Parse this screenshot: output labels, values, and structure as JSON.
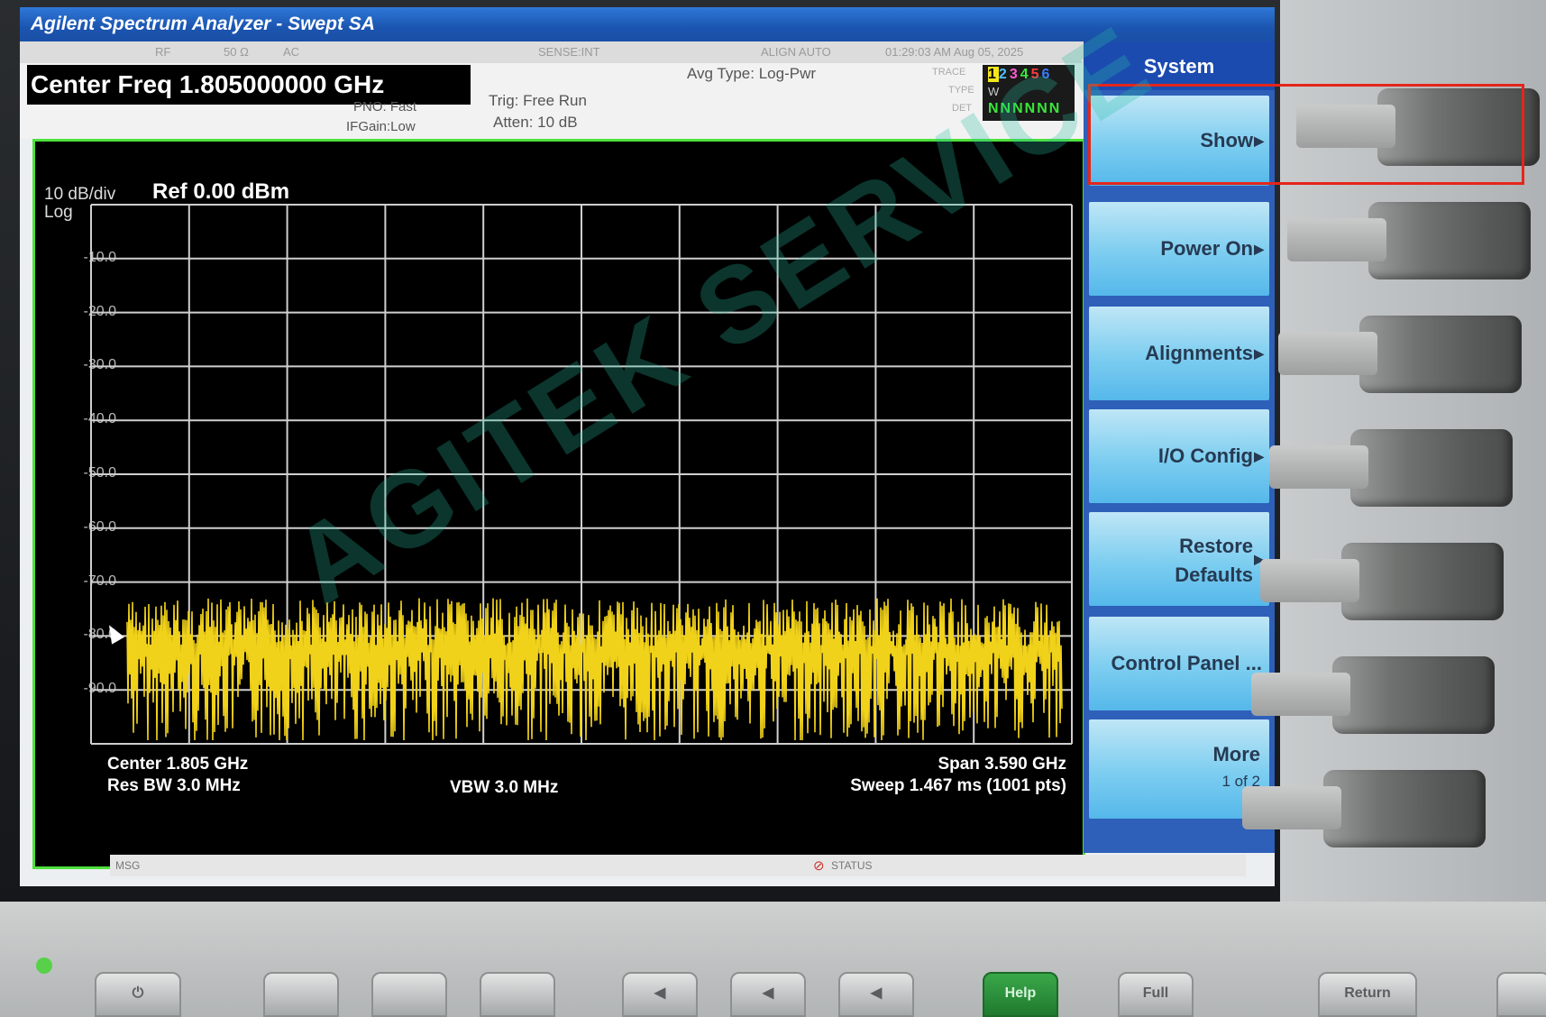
{
  "window": {
    "title": "Agilent Spectrum Analyzer - Swept SA"
  },
  "status_row": {
    "rf": "RF",
    "impedance": "50 Ω",
    "coupling": "AC",
    "sense": "SENSE:INT",
    "align": "ALIGN AUTO",
    "datetime": "01:29:03 AM Aug 05, 2025"
  },
  "measurement": {
    "center_freq": "Center Freq 1.805000000 GHz",
    "pno": "PNO: Fast",
    "if_gain": "IFGain:Low",
    "trigger": "Trig: Free Run",
    "atten": "Atten: 10 dB",
    "avg_type": "Avg Type: Log-Pwr",
    "trace_label": "TRACE",
    "type_label": "TYPE",
    "det_label": "DET",
    "trace_numbers": [
      "1",
      "2",
      "3",
      "4",
      "5",
      "6"
    ],
    "trace_colors": [
      "#f5e61c",
      "#4fc0ff",
      "#ff5cd0",
      "#3de83d",
      "#ff3b3b",
      "#3b7bff"
    ],
    "type_row": "W",
    "det_row": "NNNNNN"
  },
  "graph": {
    "scale": "10 dB/div",
    "scale_type": "Log",
    "ref": "Ref 0.00 dBm",
    "center": "Center 1.805 GHz",
    "res_bw": "Res BW 3.0 MHz",
    "vbw": "VBW 3.0 MHz",
    "span": "Span 3.590 GHz",
    "sweep": "Sweep  1.467 ms (1001 pts)",
    "y_ticks": [
      "-10.0",
      "-20.0",
      "-30.0",
      "-40.0",
      "-50.0",
      "-60.0",
      "-70.0",
      "-80.0",
      "-90.0"
    ],
    "trace_color": "#f1d21a"
  },
  "msg_bar": {
    "msg": "MSG",
    "status": "STATUS"
  },
  "softkeys": {
    "title": "System",
    "items": [
      {
        "label": "Show"
      },
      {
        "label": "Power On"
      },
      {
        "label": "Alignments"
      },
      {
        "label": "I/O Config"
      },
      {
        "line1": "Restore",
        "line2": "Defaults"
      },
      {
        "label": "Control Panel ..."
      },
      {
        "line1": "More",
        "line2": "1 of 2"
      }
    ]
  },
  "front_panel": {
    "help": "Help",
    "full": "Full",
    "return": "Return"
  },
  "watermark": "AGITEK SERVICE"
}
